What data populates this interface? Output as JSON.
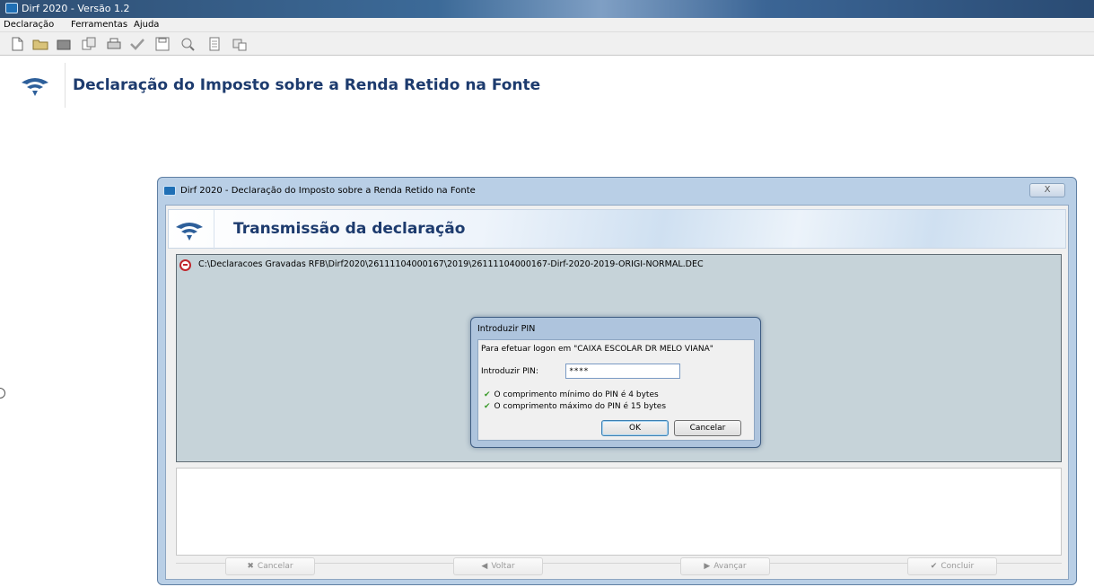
{
  "app": {
    "title": "Dirf 2020 - Versão 1.2",
    "page_title": "Declaração do Imposto sobre a Renda Retido na Fonte"
  },
  "menu": {
    "items": [
      "Declaração",
      "Ferramentas",
      "Ajuda"
    ]
  },
  "toolbar": {
    "icons": [
      "new-file-icon",
      "open-folder-icon",
      "folder-icon",
      "copy-icon",
      "print-icon",
      "checkmark-icon",
      "save-icon",
      "search-icon",
      "document-icon",
      "transmit-icon"
    ]
  },
  "dialog": {
    "title": "Dirf 2020 - Declaração do Imposto sobre a Renda Retido na Fonte",
    "close_label": "X",
    "banner_title": "Transmissão da declaração",
    "file_path": "C:\\Declaracoes Gravadas RFB\\Dirf2020\\26111104000167\\2019\\26111104000167-Dirf-2020-2019-ORIGI-NORMAL.DEC",
    "buttons": {
      "cancel": "Cancelar",
      "back": "Voltar",
      "next": "Avançar",
      "finish": "Concluir"
    }
  },
  "pin_dialog": {
    "title": "Introduzir PIN",
    "message": "Para efetuar logon em \"CAIXA ESCOLAR DR MELO VIANA\"",
    "label": "Introduzir PIN:",
    "value": "****",
    "rule_min": "O comprimento mínimo do PIN é 4 bytes",
    "rule_max": "O comprimento máximo do PIN é 15 bytes",
    "ok": "OK",
    "cancel": "Cancelar"
  },
  "colors": {
    "title_blue": "#1d3b6e",
    "dialog_frame": "#b9cfe6",
    "file_panel_bg": "#c6d3d9",
    "error_red": "#c0262c",
    "check_green": "#3a9a2a"
  }
}
